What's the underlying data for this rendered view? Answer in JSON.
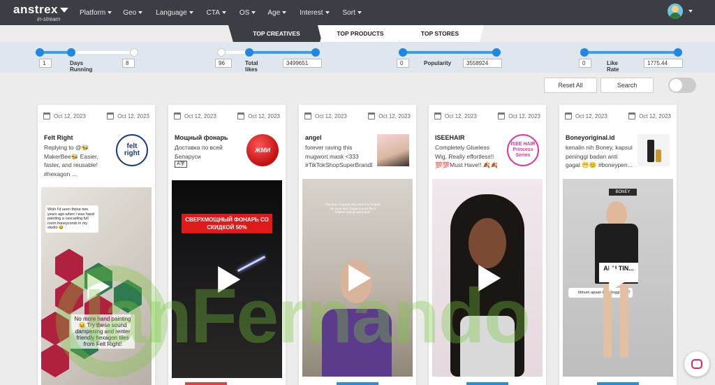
{
  "brand": {
    "name": "anstrex",
    "sub": "in-stream"
  },
  "nav": {
    "items": [
      {
        "label": "Platform"
      },
      {
        "label": "Geo"
      },
      {
        "label": "Language"
      },
      {
        "label": "CTA"
      },
      {
        "label": "OS"
      },
      {
        "label": "Age"
      },
      {
        "label": "Interest"
      },
      {
        "label": "Sort"
      }
    ]
  },
  "tabs": {
    "creatives": "TOP CREATIVES",
    "products": "TOP PRODUCTS",
    "stores": "TOP STORES"
  },
  "filters": {
    "days": {
      "label": "Days Running",
      "min": "1",
      "max": "8"
    },
    "likes": {
      "label": "Total likes",
      "min": "96",
      "max": "3499651"
    },
    "popularity": {
      "label": "Popularity",
      "min": "0",
      "max": "3558924"
    },
    "likerate": {
      "label": "Like Rate",
      "min": "0",
      "max": "1775.44"
    }
  },
  "actions": {
    "reset": "Reset All",
    "search": "Search"
  },
  "cards": [
    {
      "date1": "Oct 12, 2023",
      "date2": "Oct 12, 2023",
      "title": "Felt Right",
      "desc": "Replying to @🐝 MakerBee🐝 Easier, faster, and reusable! #hexagon ...",
      "thumb": "felt right",
      "video_caption": "No more hand painting 😖 Try these sound dampening and renter friendly hexagon tiles from Felt Right!",
      "video_comment": "Wish I'd seen these two years ago when I was hand painting a cascading full room honeycomb in my studio 😂"
    },
    {
      "date1": "Oct 12, 2023",
      "date2": "Oct 12, 2023",
      "title": "Мощный фонарь",
      "desc": "Доставка по всей Беларуси",
      "thumb": "ЖМИ",
      "video_caption": "СВЕРХМОЩНЫЙ ФОНАРЬ СО СКИДКОЙ 50%"
    },
    {
      "date1": "Oct 12, 2023",
      "date2": "Oct 12, 2023",
      "title": "angel",
      "desc": "forever raving this mugwort mask <333 #TikTokShopSuperBrandD...",
      "video_caption": "The only mugwort clay stick that helped my acne and clogged pores for a brighter and glowing skin!"
    },
    {
      "date1": "Oct 12, 2023",
      "date2": "Oct 12, 2023",
      "title": "ISEEHAIR",
      "desc": "Completely Glueless Wig, Really effortless!! 💯💯Must Have!! 🍂🍂",
      "thumb": "ISEE HAIR Princess Series"
    },
    {
      "date1": "Oct 12, 2023",
      "date2": "Oct 12, 2023",
      "title": "Boneyoriginal.id",
      "desc": "kenalin nih Boney, kapsul peninggi badan anti gagal 😁😊 #boneypen...",
      "video_caption": "Minum apaan bisa tinggi gitu ?",
      "video_sign": "BONEY",
      "video_sticker": "APU TIN..."
    }
  ],
  "watermark": "IanFernando"
}
